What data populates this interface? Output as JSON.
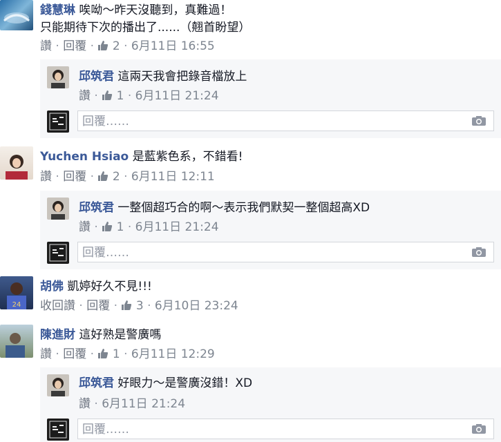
{
  "comments": [
    {
      "author": "錢慧琳",
      "text_line1": "唉呦～昨天沒聽到，真難過！",
      "text_line2": "只能期待下次的播出了......（翹首盼望）",
      "actions": [
        "讚",
        "回覆"
      ],
      "likes": "2",
      "time": "6月11日 16:55",
      "reply": {
        "author": "邱筑君",
        "text": "這兩天我會把錄音檔放上",
        "actions": [
          "讚"
        ],
        "likes": "1",
        "time": "6月11日 21:24"
      },
      "reply_placeholder": "回覆……"
    },
    {
      "author": "Yuchen Hsiao",
      "text": "是藍紫色系，不錯看!",
      "actions": [
        "讚",
        "回覆"
      ],
      "likes": "2",
      "time": "6月11日 12:11",
      "reply": {
        "author": "邱筑君",
        "text": "一整個超巧合的啊～表示我們默契一整個超高XD",
        "actions": [
          "讚"
        ],
        "likes": "1",
        "time": "6月11日 21:24"
      },
      "reply_placeholder": "回覆……"
    },
    {
      "author": "胡佛",
      "text": "凱婷好久不見!!!",
      "actions": [
        "收回讚",
        "回覆"
      ],
      "likes": "3",
      "time": "6月10日 23:24"
    },
    {
      "author": "陳進財",
      "text": "這好熟是警廣嗎",
      "actions": [
        "讚",
        "回覆"
      ],
      "likes": "1",
      "time": "6月11日 12:29",
      "reply": {
        "author": "邱筑君",
        "text": "好眼力～是警廣沒錯！XD",
        "actions": [
          "讚"
        ],
        "time": "6月11日 21:24"
      },
      "reply_placeholder": "回覆……"
    }
  ],
  "colors": {
    "link": "#3b5998",
    "meta": "#7d8590",
    "reply_bg": "#f6f7f9",
    "border": "#d3d6db"
  },
  "icons": {
    "like": "thumbs-up-icon",
    "camera": "camera-icon"
  }
}
